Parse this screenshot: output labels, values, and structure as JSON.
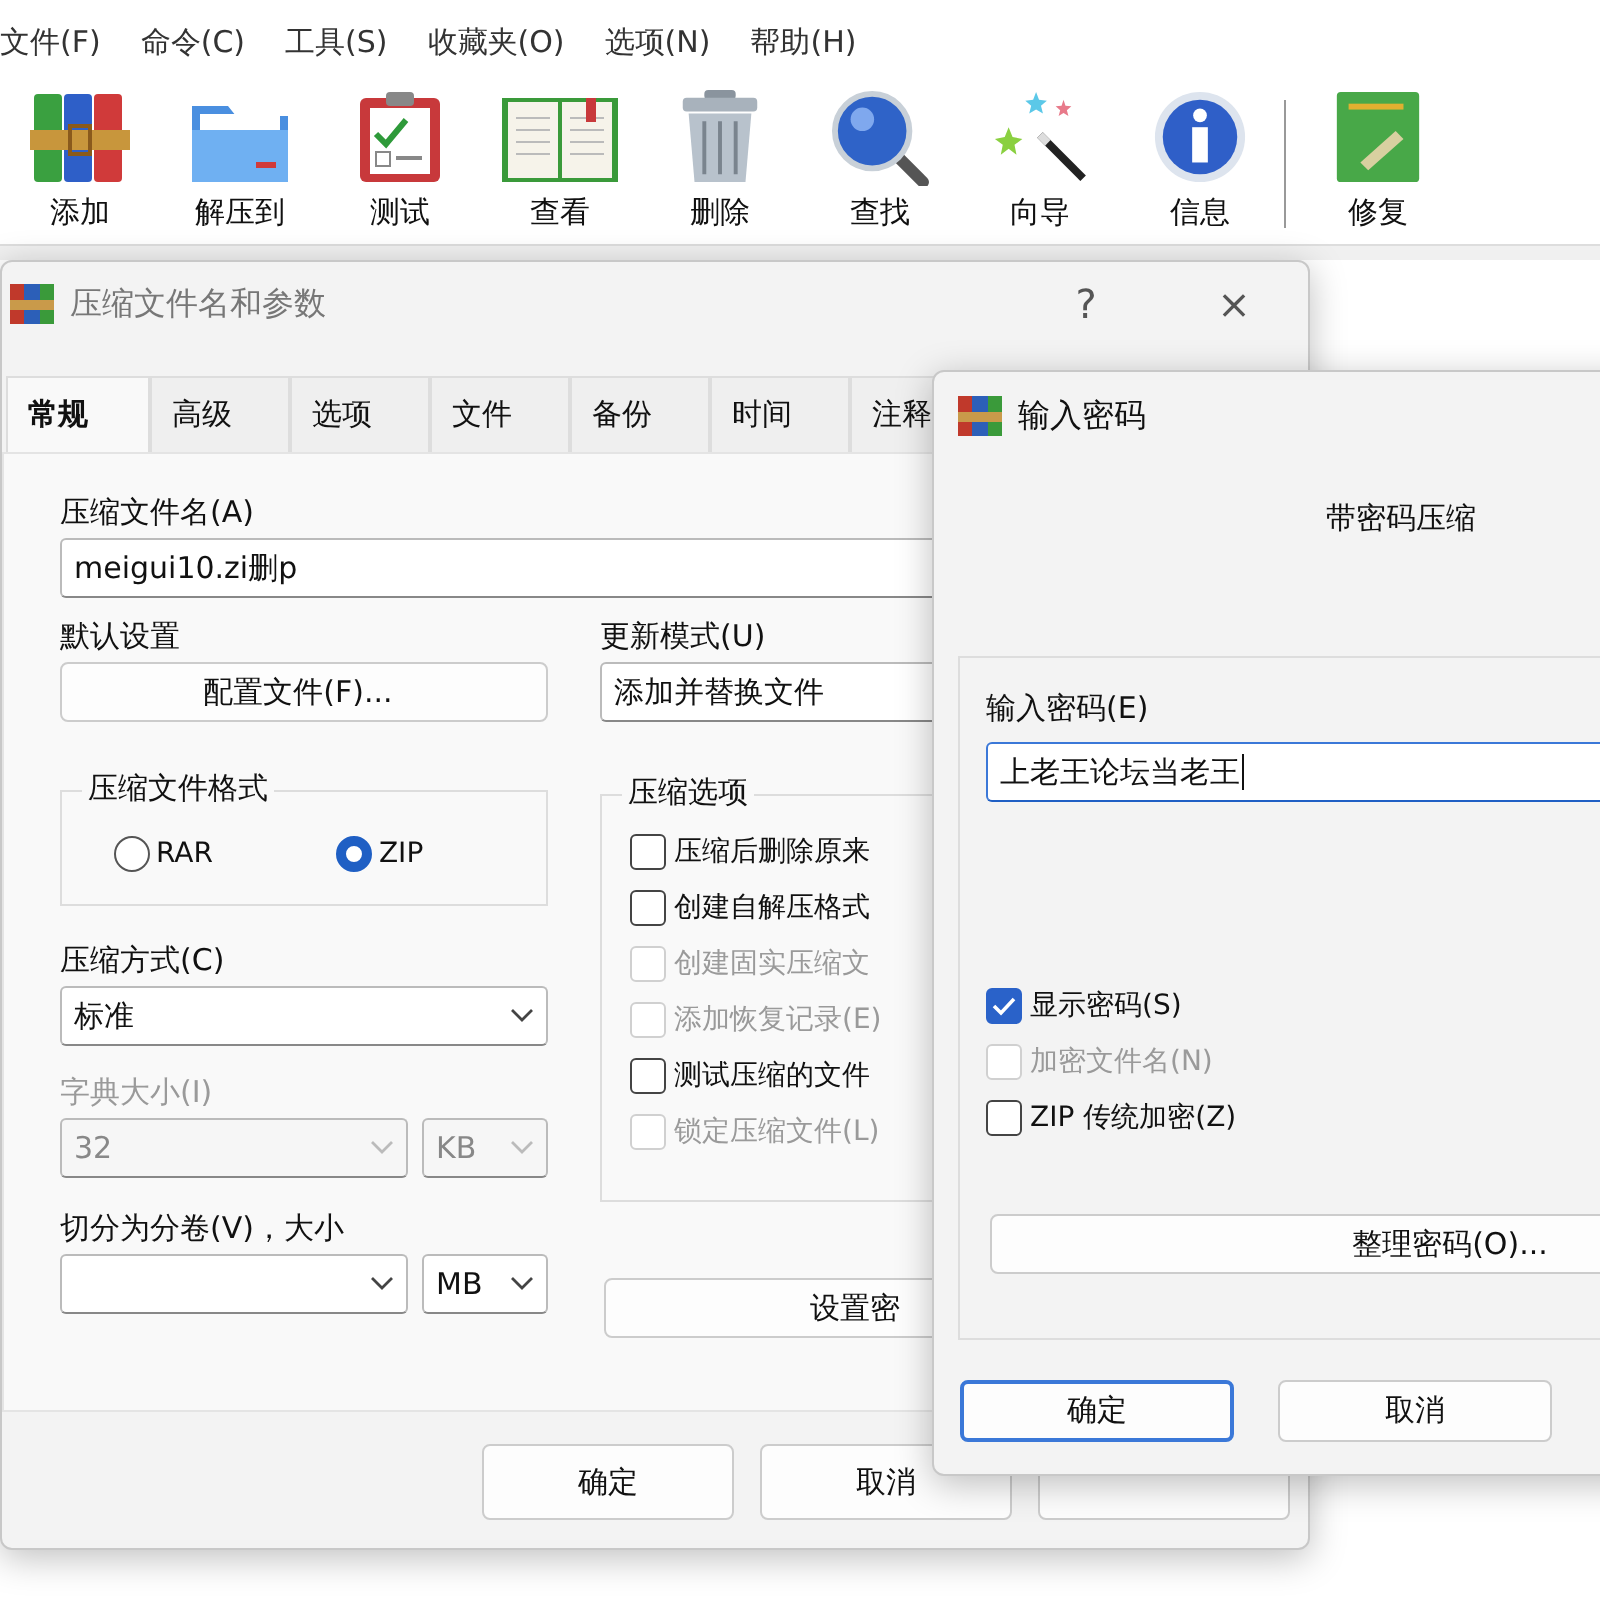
{
  "menu_bar": [
    "文件(F)",
    "命令(C)",
    "工具(S)",
    "收藏夹(O)",
    "选项(N)",
    "帮助(H)"
  ],
  "toolbar": {
    "groups": [
      [
        "添加",
        "解压到",
        "测试",
        "查看",
        "删除",
        "查找",
        "向导",
        "信息"
      ],
      [
        "修复"
      ]
    ]
  },
  "archive_dialog": {
    "title": "压缩文件名和参数",
    "help": "?",
    "close": "×",
    "tabs": [
      {
        "label": "常规",
        "selected": true
      },
      {
        "label": "高级",
        "selected": false
      },
      {
        "label": "选项",
        "selected": false
      },
      {
        "label": "文件",
        "selected": false
      },
      {
        "label": "备份",
        "selected": false
      },
      {
        "label": "时间",
        "selected": false
      },
      {
        "label": "注释",
        "selected": false
      }
    ],
    "archive_name": {
      "label": "压缩文件名(A)",
      "value": "meigui10.zi删p"
    },
    "profile": {
      "label": "默认设置",
      "button": "配置文件(F)..."
    },
    "update_mode": {
      "label": "更新模式(U)",
      "value": "添加并替换文件"
    },
    "format": {
      "title": "压缩文件格式",
      "options": [
        {
          "label": "RAR",
          "selected": false
        },
        {
          "label": "ZIP",
          "selected": true
        }
      ]
    },
    "method": {
      "label": "压缩方式(C)",
      "value": "标准"
    },
    "dictionary": {
      "label": "字典大小(I)",
      "value": "32",
      "unit": "KB",
      "disabled": true
    },
    "split": {
      "label": "切分为分卷(V)，大小",
      "unit": "MB"
    },
    "options": {
      "title": "压缩选项",
      "items": [
        {
          "label": "压缩后删除原来",
          "checked": false,
          "disabled": false
        },
        {
          "label": "创建自解压格式",
          "checked": false,
          "disabled": false
        },
        {
          "label": "创建固实压缩文",
          "checked": false,
          "disabled": true
        },
        {
          "label": "添加恢复记录(E)",
          "checked": false,
          "disabled": true
        },
        {
          "label": "测试压缩的文件",
          "checked": false,
          "disabled": false
        },
        {
          "label": "锁定压缩文件(L)",
          "checked": false,
          "disabled": true
        }
      ]
    },
    "password_button": "设置密",
    "buttons": [
      "确定",
      "取消"
    ],
    "covered_button": true
  },
  "password_dialog": {
    "title": "输入密码",
    "heading": "带密码压缩",
    "password": {
      "label": "输入密码(E)",
      "value": "上老王论坛当老王"
    },
    "checks": [
      {
        "label": "显示密码(S)",
        "checked": true,
        "disabled": false
      },
      {
        "label": "加密文件名(N)",
        "checked": false,
        "disabled": true
      },
      {
        "label": "ZIP 传统加密(Z)",
        "checked": false,
        "disabled": false
      }
    ],
    "organize_button": "整理密码(O)...",
    "buttons": [
      {
        "label": "确定",
        "default": true
      },
      {
        "label": "取消",
        "default": false
      }
    ]
  }
}
